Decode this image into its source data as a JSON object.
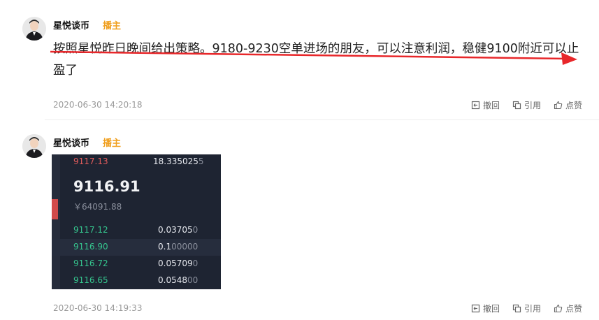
{
  "post1": {
    "username": "星悦谈币",
    "badge": "播主",
    "content": "按照星悦昨日晚间给出策略。9180-9230空单进场的朋友，可以注意利润，稳健9100附近可以止盈了",
    "timestamp": "2020-06-30 14:20:18",
    "actions": {
      "withdraw": "撤回",
      "quote": "引用",
      "like": "点赞"
    }
  },
  "post2": {
    "username": "星悦谈币",
    "badge": "播主",
    "timestamp": "2020-06-30 14:19:33",
    "actions": {
      "withdraw": "撤回",
      "quote": "引用",
      "like": "点赞"
    },
    "trade_image": {
      "top_row": {
        "price": "9117.13",
        "qty": "18.335025",
        "tail": "5"
      },
      "last_price": "9116.91",
      "cny_price": "￥64091.88",
      "bids": [
        {
          "price": "9117.12",
          "qty": "0.03705",
          "tail": "0"
        },
        {
          "price": "9116.90",
          "qty": "0.1",
          "tail": "00000"
        },
        {
          "price": "9116.72",
          "qty": "0.05709",
          "tail": "0"
        },
        {
          "price": "9116.65",
          "qty": "0.0548",
          "tail": "00"
        }
      ]
    }
  },
  "colors": {
    "badge": "#f0a020",
    "ask": "#e35c5c",
    "bid": "#35c58e",
    "annotation_arrow": "#e8272a"
  }
}
